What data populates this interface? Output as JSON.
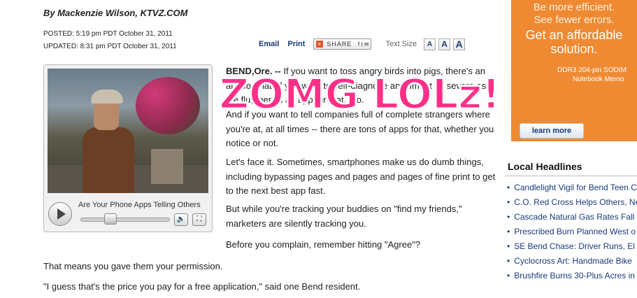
{
  "article": {
    "byline": "By Mackenzie Wilson, KTVZ.COM",
    "posted": "POSTED: 5:19 pm PDT October 31, 2011",
    "updated": "UPDATED: 8:31 pm PDT October 31, 2011",
    "tools": {
      "email": "Email",
      "print": "Print",
      "share": "SHARE",
      "text_size_label": "Text Size",
      "sizes": [
        "A",
        "A",
        "A"
      ]
    },
    "video_caption": "Are Your Phone Apps Telling Others",
    "paragraphs": [
      {
        "lead": "BEND,Ore. --",
        "text": " If you want to toss angry birds into pigs, there's an app for that. If you want to self-diagnose an ailment as severe as the flu, there's an app for that, too."
      },
      {
        "lead": "",
        "text": "And if you want to tell companies full of complete strangers where you're at, at all times -- there are tons of apps for that, whether you notice or not."
      },
      {
        "lead": "",
        "text": "Let's face it. Sometimes, smartphones make us do dumb things, including bypassing pages and pages and pages of fine print to get to the next best app fast."
      },
      {
        "lead": "",
        "text": "But while you're tracking your buddies on \"find my friends,\" marketers are silently tracking you."
      },
      {
        "lead": "",
        "text": "Before you complain, remember hitting \"Agree\"?"
      },
      {
        "lead": "",
        "text": "That means you gave them your permission."
      },
      {
        "lead": "",
        "text": "\"I guess that's the price you pay for a free application,\" said one Bend resident."
      }
    ],
    "overlay_text": "ZOMG LOLz!!"
  },
  "ad": {
    "line1": "Be more efficient.",
    "line2": "See fewer errors.",
    "line3": "Get an affordable",
    "line4": "solution.",
    "product1": "DDR3 204-pin SODIM",
    "product2": "Notebook Memo",
    "button": "learn more"
  },
  "local_headlines": {
    "title": "Local Headlines",
    "items": [
      "Candlelight Vigil for Bend Teen C",
      "C.O. Red Cross Helps Others, Ne",
      "Cascade Natural Gas Rates Fall",
      "Prescribed Burn Planned West o",
      "SE Bend Chase: Driver Runs, El",
      "Cyclocross Art: Handmade Bike",
      "Brushfire Burns 30-Plus Acres in"
    ]
  },
  "colors": {
    "link": "#1a3a78",
    "overlay": "#ff2f87",
    "ad_bg": "#ef8a33"
  }
}
